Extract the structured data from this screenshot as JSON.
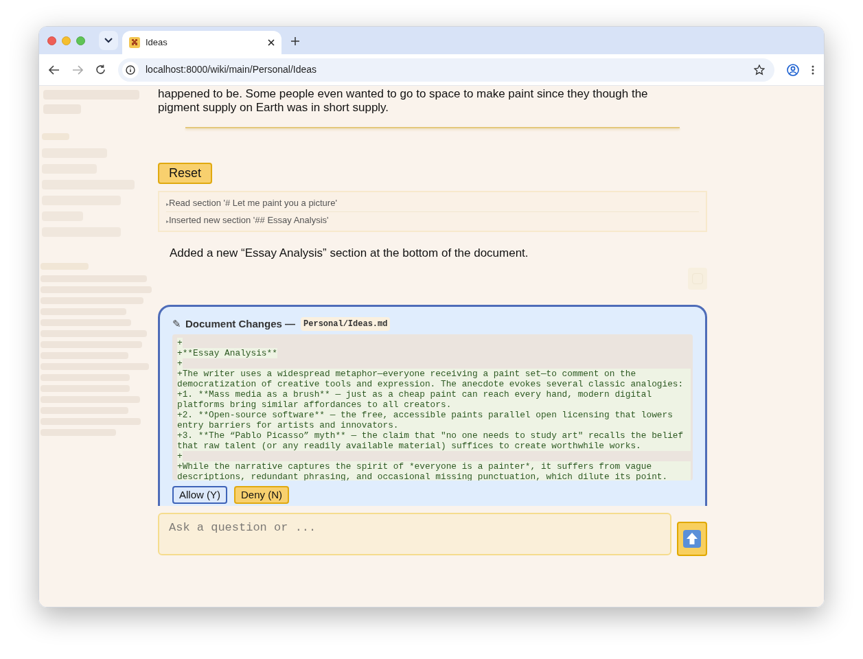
{
  "browser": {
    "tab": {
      "title": "Ideas",
      "selected": true
    },
    "address": "localhost:8000/wiki/main/Personal/Ideas"
  },
  "article": {
    "text": "happened to be. Some people even wanted to go to space to make paint since they though the pigment supply on Earth was in short supply."
  },
  "reset_button": "Reset",
  "tool_log": [
    {
      "marker": "▸",
      "text": "Read section '# Let me paint you a picture'"
    },
    {
      "marker": "▸",
      "text": "Inserted new section '## Essay Analysis'"
    }
  ],
  "assistant_message": "Added a new “Essay Analysis” section at the bottom of the document.",
  "changes": {
    "icon": "✎",
    "title": "Document Changes —",
    "file": "Personal/Ideas.md",
    "diff_lines": [
      "+",
      "+**Essay Analysis**",
      "+",
      "+The writer uses a widespread metaphor—everyone receiving a paint set—to comment on the democratization of creative tools and expression. The anecdote evokes several classic analogies:",
      "+1. **Mass media as a brush** — just as a cheap paint can reach every hand, modern digital platforms bring similar affordances to all creators.",
      "+2. **Open-source software** — the free, accessible paints parallel open licensing that lowers entry barriers for artists and innovators.",
      "+3. **The “Pablo Picasso” myth** — the claim that \"no one needs to study art\" recalls the belief that raw talent (or any readily available material) suffices to create worthwhile works.",
      "+",
      "+While the narrative captures the spirit of *everyone is a painter*, it suffers from vague descriptions, redundant phrasing, and occasional missing punctuation, which dilute its point."
    ],
    "buttons": [
      {
        "label": "Allow (Y)",
        "kind": "allow"
      },
      {
        "label": "Deny (N)",
        "kind": "deny"
      }
    ]
  },
  "composer": {
    "placeholder": "Ask a question or ..."
  }
}
